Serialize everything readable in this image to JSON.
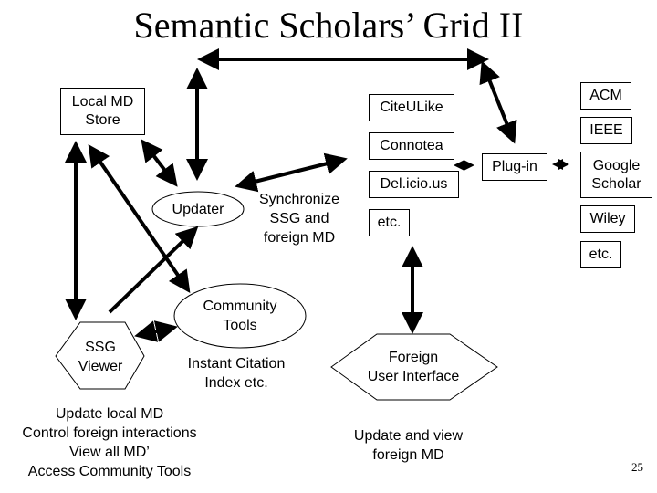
{
  "title": "Semantic Scholars’ Grid II",
  "nodes": {
    "local_md_store": "Local MD\nStore",
    "updater": "Updater",
    "synchronize": [
      "Synchronize",
      "SSG and",
      "foreign MD"
    ],
    "community_tools": [
      "Community",
      "Tools"
    ],
    "instant_citation": [
      "Instant Citation",
      "Index etc."
    ],
    "ssg_viewer": [
      "SSG",
      "Viewer"
    ],
    "ssg_viewer_desc": [
      "Update local MD",
      "Control foreign interactions",
      "View all MD’",
      "Access Community Tools"
    ],
    "social_sites": [
      "CiteULike",
      "Connotea",
      "Del.icio.us",
      "etc."
    ],
    "plugin": "Plug-in",
    "publishers": [
      "ACM",
      "IEEE",
      "Google Scholar",
      "Wiley",
      "etc."
    ],
    "foreign_ui": [
      "Foreign",
      "User Interface"
    ],
    "foreign_ui_desc": [
      "Update and view",
      "foreign MD"
    ]
  },
  "page_number": "25"
}
